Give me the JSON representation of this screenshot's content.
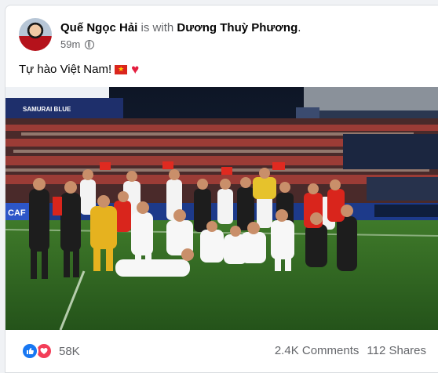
{
  "post": {
    "author": "Quế Ngọc Hải",
    "with_text": "is with",
    "tagged": "Dương Thuỳ Phương",
    "period": ".",
    "time": "59m",
    "text": "Tự hào Việt Nam!",
    "flag_glyph": "★",
    "heart_glyph": "♥"
  },
  "photo": {
    "board_text": "SAMURAI BLUE",
    "banner_text": "CAF"
  },
  "footer": {
    "reaction_count": "58K",
    "comments": "2.4K Comments",
    "shares": "112 Shares"
  },
  "colors": {
    "facebook_blue": "#1877f2",
    "love_red": "#f33e58",
    "vietnam_red": "#da251d",
    "vietnam_yellow": "#ffcd00"
  },
  "icons": [
    "globe-icon",
    "like-icon",
    "love-icon",
    "flag-icon",
    "heart-emoji"
  ]
}
